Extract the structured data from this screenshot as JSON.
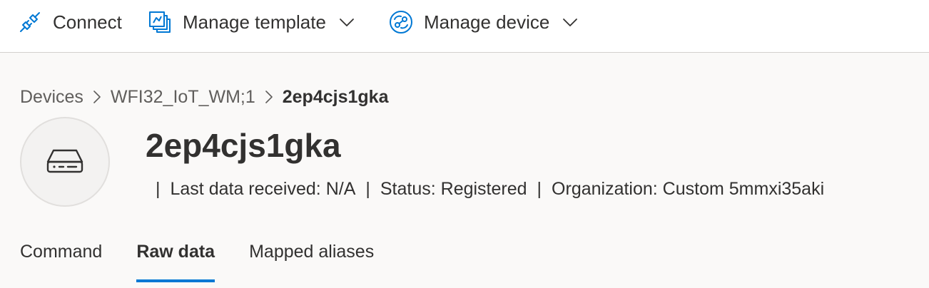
{
  "command_bar": {
    "connect": {
      "label": "Connect",
      "icon": "plug-icon"
    },
    "manage_template": {
      "label": "Manage template",
      "icon": "template-icon"
    },
    "manage_device": {
      "label": "Manage device",
      "icon": "device-settings-icon"
    }
  },
  "breadcrumb": {
    "items": [
      "Devices",
      "WFI32_IoT_WM;1",
      "2ep4cjs1gka"
    ]
  },
  "device": {
    "name": "2ep4cjs1gka",
    "icon": "device-icon",
    "last_data": "Last data received: N/A",
    "status": "Status: Registered",
    "organization": "Organization: Custom 5mmxi35aki"
  },
  "tabs": [
    {
      "label": "Command",
      "active": false
    },
    {
      "label": "Raw data",
      "active": true
    },
    {
      "label": "Mapped aliases",
      "active": false
    }
  ],
  "colors": {
    "accent": "#0078d4",
    "page_background": "#faf9f8",
    "command_bar_background": "#ffffff"
  }
}
